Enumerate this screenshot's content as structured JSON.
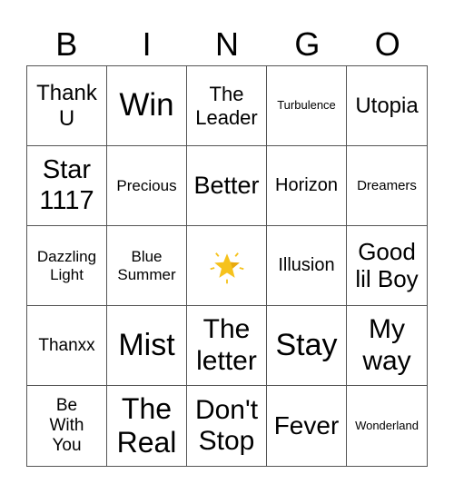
{
  "header": {
    "letters": [
      "B",
      "I",
      "N",
      "G",
      "O"
    ]
  },
  "card": {
    "cells": [
      {
        "text": "Thank U"
      },
      {
        "text": "Win"
      },
      {
        "text": "The Leader"
      },
      {
        "text": "Turbulence"
      },
      {
        "text": "Utopia"
      },
      {
        "text": "Star 1117"
      },
      {
        "text": "Precious"
      },
      {
        "text": "Better"
      },
      {
        "text": "Horizon"
      },
      {
        "text": "Dreamers"
      },
      {
        "text": "Dazzling Light"
      },
      {
        "text": "Blue Summer"
      },
      {
        "icon": "glowing-star-icon",
        "free_space": true
      },
      {
        "text": "Illusion"
      },
      {
        "text": "Good lil Boy"
      },
      {
        "text": "Thanxx"
      },
      {
        "text": "Mist"
      },
      {
        "text": "The letter"
      },
      {
        "text": "Stay"
      },
      {
        "text": "My way"
      },
      {
        "text": "Be With You"
      },
      {
        "text": "The Real"
      },
      {
        "text": "Don't Stop"
      },
      {
        "text": "Fever"
      },
      {
        "text": "Wonderland"
      }
    ]
  },
  "colors": {
    "star": "#f9c623",
    "grid_line": "#555555"
  }
}
